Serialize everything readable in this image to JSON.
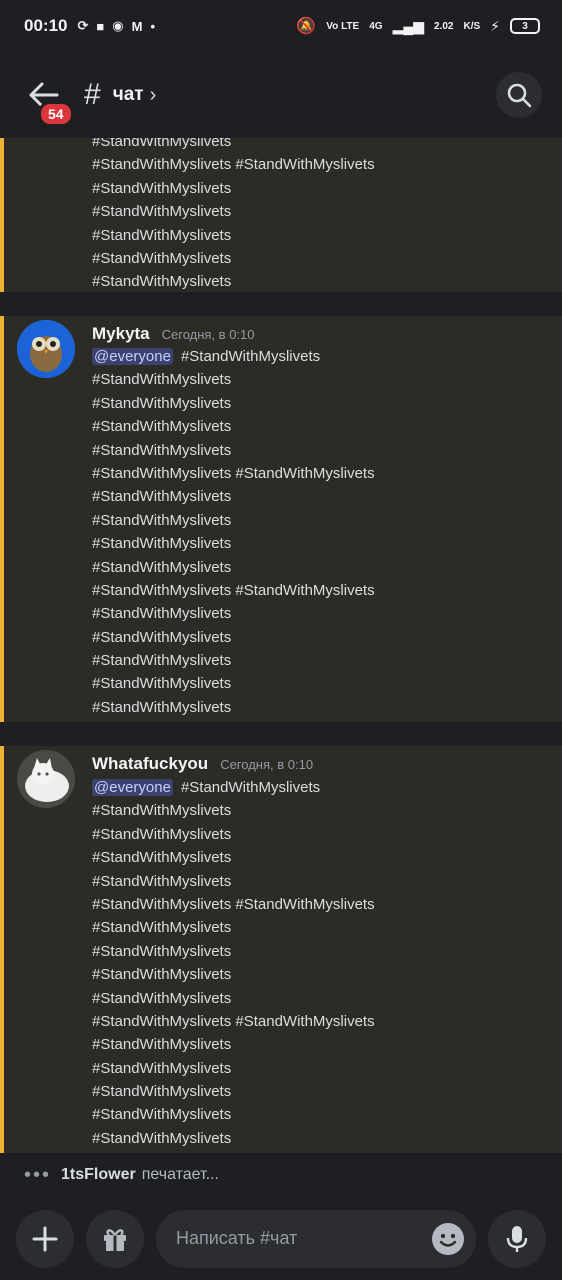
{
  "status": {
    "time": "00:10",
    "network": "4G",
    "speed_value": "2.02",
    "speed_unit": "K/S",
    "lte": "Vo LTE",
    "battery": "3"
  },
  "header": {
    "badge": "54",
    "channel": "чат"
  },
  "messages": [
    {
      "author": "",
      "timestamp": "",
      "lines": [
        "#StandWithMyslivets",
        "#StandWithMyslivets #StandWithMyslivets",
        "#StandWithMyslivets",
        "#StandWithMyslivets",
        "#StandWithMyslivets",
        "#StandWithMyslivets",
        "#StandWithMyslivets"
      ]
    },
    {
      "author": "Mykyta",
      "timestamp": "Сегодня, в 0:10",
      "mention": "@everyone",
      "first_line": "#StandWithMyslivets",
      "lines": [
        "#StandWithMyslivets",
        "#StandWithMyslivets",
        "#StandWithMyslivets",
        "#StandWithMyslivets",
        "#StandWithMyslivets #StandWithMyslivets",
        "#StandWithMyslivets",
        "#StandWithMyslivets",
        "#StandWithMyslivets",
        "#StandWithMyslivets",
        "#StandWithMyslivets #StandWithMyslivets",
        "#StandWithMyslivets",
        "#StandWithMyslivets",
        "#StandWithMyslivets",
        "#StandWithMyslivets",
        "#StandWithMyslivets"
      ]
    },
    {
      "author": "Whatafuckyou",
      "timestamp": "Сегодня, в 0:10",
      "mention": "@everyone",
      "first_line": "#StandWithMyslivets",
      "lines": [
        "#StandWithMyslivets",
        "#StandWithMyslivets",
        "#StandWithMyslivets",
        "#StandWithMyslivets",
        "#StandWithMyslivets #StandWithMyslivets",
        "#StandWithMyslivets",
        "#StandWithMyslivets",
        "#StandWithMyslivets",
        "#StandWithMyslivets",
        "#StandWithMyslivets #StandWithMyslivets",
        "#StandWithMyslivets",
        "#StandWithMyslivets",
        "#StandWithMyslivets",
        "#StandWithMyslivets",
        "#StandWithMyslivets"
      ]
    }
  ],
  "typing": {
    "user": "1tsFlower",
    "text": "печатает..."
  },
  "composer": {
    "placeholder": "Написать #чат"
  },
  "icons": {
    "back": "back-arrow-icon",
    "channel": "hash-icon",
    "search": "search-icon",
    "add": "plus-icon",
    "gift": "gift-icon",
    "emoji": "emoji-icon",
    "mic": "microphone-icon"
  },
  "colors": {
    "accent_bar": "#f0b232",
    "mention_bg": "#3c4270",
    "badge": "#da373c",
    "highlight_bg": "#2c2b25"
  }
}
